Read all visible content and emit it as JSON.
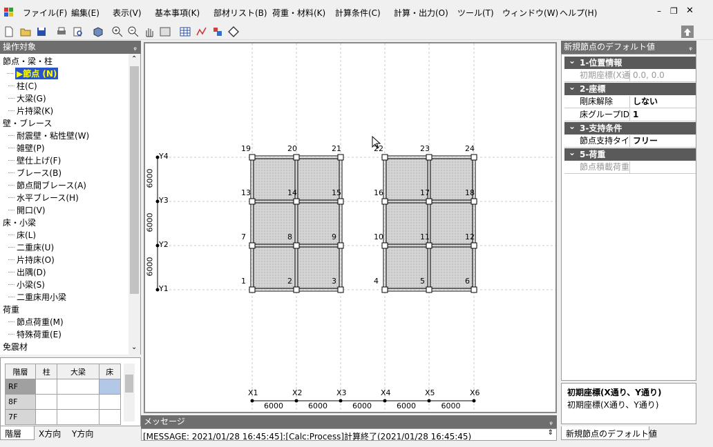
{
  "menu": [
    "ファイル(F)",
    "編集(E)",
    "表示(V)",
    "基本事項(K)",
    "部材リスト(B)",
    "荷重・材料(K)",
    "計算条件(C)",
    "計算・出力(O)",
    "ツール(T)",
    "ウィンドウ(W)",
    "ヘルプ(H)"
  ],
  "window_controls": {
    "minimize": "–",
    "restore": "❐",
    "close": "✕"
  },
  "left_panel": {
    "title": "操作対象",
    "pin": "ᵩ",
    "tree": [
      {
        "label": "節点・梁・柱",
        "level": 0
      },
      {
        "label": "▶節点 (N)",
        "level": 1,
        "selected": true
      },
      {
        "label": "柱(C)",
        "level": 1
      },
      {
        "label": "大梁(G)",
        "level": 1
      },
      {
        "label": "片持梁(K)",
        "level": 1
      },
      {
        "label": "壁・ブレース",
        "level": 0
      },
      {
        "label": "耐震壁・粘性壁(W)",
        "level": 1
      },
      {
        "label": "雑壁(P)",
        "level": 1
      },
      {
        "label": "壁仕上げ(F)",
        "level": 1
      },
      {
        "label": "ブレース(B)",
        "level": 1
      },
      {
        "label": "節点間ブレース(A)",
        "level": 1
      },
      {
        "label": "水平ブレース(H)",
        "level": 1
      },
      {
        "label": "開口(V)",
        "level": 1
      },
      {
        "label": "床・小梁",
        "level": 0
      },
      {
        "label": "床(L)",
        "level": 1
      },
      {
        "label": "二重床(U)",
        "level": 1
      },
      {
        "label": "片持床(O)",
        "level": 1
      },
      {
        "label": "出隅(D)",
        "level": 1
      },
      {
        "label": "小梁(S)",
        "level": 1
      },
      {
        "label": "二重床用小梁",
        "level": 1
      },
      {
        "label": "荷重",
        "level": 0
      },
      {
        "label": "節点荷重(M)",
        "level": 1
      },
      {
        "label": "特殊荷重(E)",
        "level": 1
      },
      {
        "label": "免震材",
        "level": 0
      }
    ]
  },
  "floor_table": {
    "headers": [
      "階層",
      "柱",
      "大梁",
      "床"
    ],
    "rows": [
      "RF",
      "8F",
      "7F"
    ]
  },
  "bottom_tabs": [
    "階層",
    "X方向",
    "Y方向"
  ],
  "canvas": {
    "y_axes": [
      "Y4",
      "Y3",
      "Y2",
      "Y1"
    ],
    "y_spans": [
      "6000",
      "6000",
      "6000"
    ],
    "x_axes": [
      "X1",
      "X2",
      "X3",
      "X4",
      "X5",
      "X6"
    ],
    "x_spans": [
      "6000",
      "6000",
      "6000",
      "6000",
      "6000"
    ],
    "nodes": [
      "1",
      "2",
      "3",
      "4",
      "5",
      "6",
      "7",
      "8",
      "9",
      "10",
      "11",
      "12",
      "13",
      "14",
      "15",
      "16",
      "17",
      "18",
      "19",
      "20",
      "21",
      "22",
      "23",
      "24"
    ]
  },
  "message": {
    "title": "メッセージ",
    "text": "[MESSAGE: 2021/01/28 16:45:45]:[Calc:Process]計算終了(2021/01/28 16:45:45)"
  },
  "right_panel": {
    "title": "新規節点のデフォルト値",
    "categories": [
      {
        "label": "1-位置情報",
        "rows": [
          {
            "key": "初期座標(X通",
            "value": "0.0, 0.0",
            "disabled": true
          }
        ]
      },
      {
        "label": "2-座標",
        "rows": [
          {
            "key": "剛床解除",
            "value": "しない"
          },
          {
            "key": "床グループID",
            "value": "1"
          }
        ]
      },
      {
        "label": "3-支持条件",
        "rows": [
          {
            "key": "節点支持タイプ",
            "value": "フリー"
          }
        ]
      },
      {
        "label": "5-荷重",
        "rows": [
          {
            "key": "節点積載荷重",
            "value": "",
            "disabled": true
          }
        ]
      }
    ],
    "help_title": "初期座標(X通り、Y通り)",
    "help_text": "初期座標(X通り、Y通り)",
    "tab": "新規節点のデフォルト値"
  },
  "colors": {
    "selected_bg": "#2a55c8",
    "selected_fg": "#ffff00",
    "panel_title": "#6e6e6e",
    "slab": "#d4d4d4"
  }
}
